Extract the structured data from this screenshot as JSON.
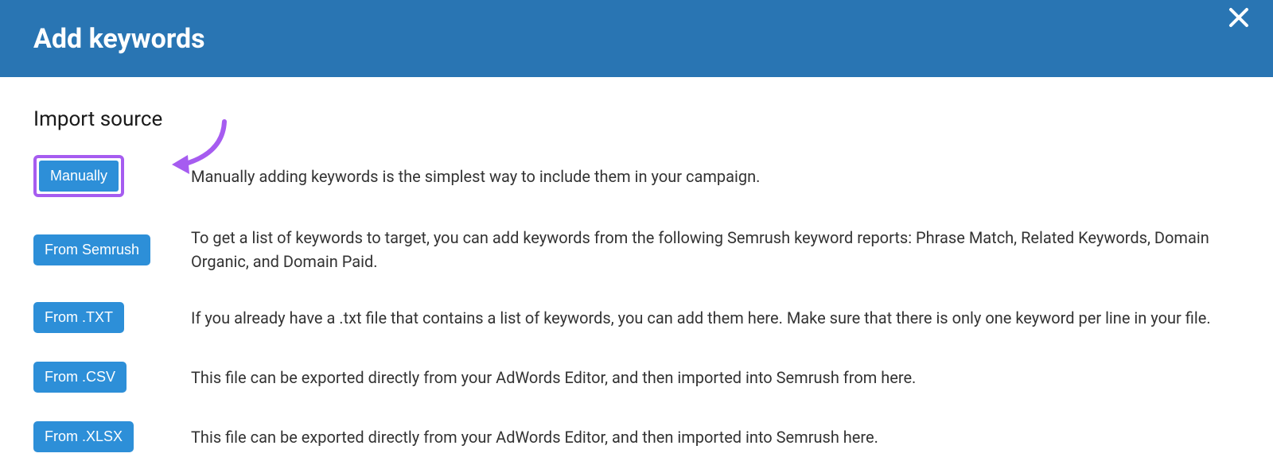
{
  "header": {
    "title": "Add keywords"
  },
  "section": {
    "title": "Import source"
  },
  "options": [
    {
      "button_label": "Manually",
      "description": "Manually adding keywords is the simplest way to include them in your campaign.",
      "highlighted": true
    },
    {
      "button_label": "From Semrush",
      "description": "To get a list of keywords to target, you can add keywords from the following Semrush keyword reports: Phrase Match, Related Keywords, Domain Organic, and Domain Paid."
    },
    {
      "button_label": "From .TXT",
      "description": "If you already have a .txt file that contains a list of keywords, you can add them here. Make sure that there is only one keyword per line in your file."
    },
    {
      "button_label": "From .CSV",
      "description": "This file can be exported directly from your AdWords Editor, and then imported into Semrush from here."
    },
    {
      "button_label": "From .XLSX",
      "description": "This file can be exported directly from your AdWords Editor, and then imported into Semrush here."
    }
  ],
  "colors": {
    "header_bg": "#2975b3",
    "button_bg": "#2d8fd8",
    "highlight_border": "#a65cf0"
  }
}
